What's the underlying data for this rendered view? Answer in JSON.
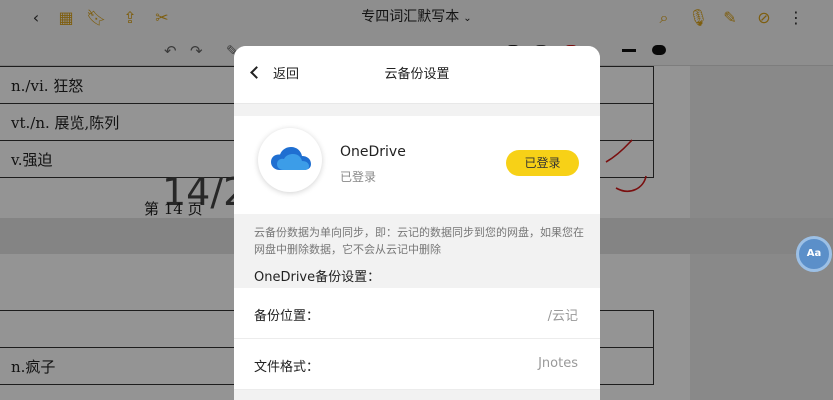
{
  "document": {
    "title": "专四词汇默写本",
    "page_label": "第 14 页",
    "big_page_number": "14/2"
  },
  "vocab_rows_top": [
    {
      "pos_meaning": "n./vi. 狂怒"
    },
    {
      "pos_meaning": "vt./n. 展览,陈列"
    },
    {
      "pos_meaning": "v.强迫"
    }
  ],
  "vocab_rows_bottom": [
    {
      "pos_meaning": ""
    },
    {
      "pos_meaning": "n.疯子"
    }
  ],
  "assistant_badge": "Aa",
  "modal": {
    "back_label": "返回",
    "title": "云备份设置",
    "provider": {
      "name": "OneDrive",
      "status": "已登录",
      "button_label": "已登录"
    },
    "note": "云备份数据为单向同步，即：云记的数据同步到您的网盘，如果您在网盘中删除数据，它不会从云记中删除",
    "section_title": "OneDrive备份设置：",
    "settings": [
      {
        "label": "备份位置：",
        "value": "/云记"
      },
      {
        "label": "文件格式：",
        "value": "Jnotes"
      }
    ]
  },
  "colors": {
    "accent_yellow": "#f7d117",
    "onedrive_blue": "#1f6fd1",
    "annotation_red": "#d21a1a"
  }
}
